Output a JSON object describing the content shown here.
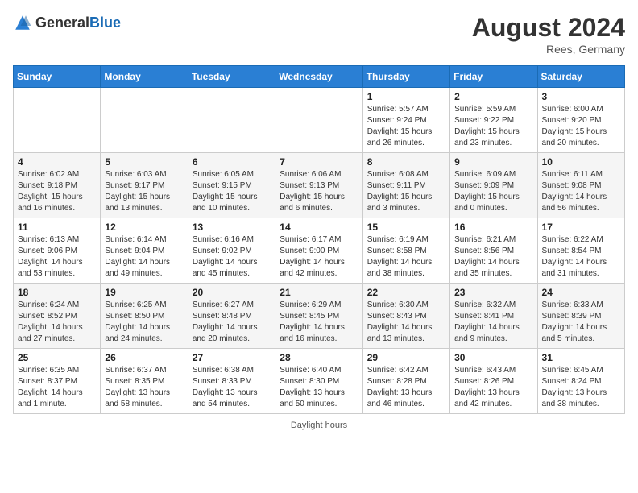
{
  "header": {
    "logo_general": "General",
    "logo_blue": "Blue",
    "month_year": "August 2024",
    "location": "Rees, Germany"
  },
  "days_of_week": [
    "Sunday",
    "Monday",
    "Tuesday",
    "Wednesday",
    "Thursday",
    "Friday",
    "Saturday"
  ],
  "weeks": [
    [
      {
        "day": "",
        "info": ""
      },
      {
        "day": "",
        "info": ""
      },
      {
        "day": "",
        "info": ""
      },
      {
        "day": "",
        "info": ""
      },
      {
        "day": "1",
        "info": "Sunrise: 5:57 AM\nSunset: 9:24 PM\nDaylight: 15 hours and 26 minutes."
      },
      {
        "day": "2",
        "info": "Sunrise: 5:59 AM\nSunset: 9:22 PM\nDaylight: 15 hours and 23 minutes."
      },
      {
        "day": "3",
        "info": "Sunrise: 6:00 AM\nSunset: 9:20 PM\nDaylight: 15 hours and 20 minutes."
      }
    ],
    [
      {
        "day": "4",
        "info": "Sunrise: 6:02 AM\nSunset: 9:18 PM\nDaylight: 15 hours and 16 minutes."
      },
      {
        "day": "5",
        "info": "Sunrise: 6:03 AM\nSunset: 9:17 PM\nDaylight: 15 hours and 13 minutes."
      },
      {
        "day": "6",
        "info": "Sunrise: 6:05 AM\nSunset: 9:15 PM\nDaylight: 15 hours and 10 minutes."
      },
      {
        "day": "7",
        "info": "Sunrise: 6:06 AM\nSunset: 9:13 PM\nDaylight: 15 hours and 6 minutes."
      },
      {
        "day": "8",
        "info": "Sunrise: 6:08 AM\nSunset: 9:11 PM\nDaylight: 15 hours and 3 minutes."
      },
      {
        "day": "9",
        "info": "Sunrise: 6:09 AM\nSunset: 9:09 PM\nDaylight: 15 hours and 0 minutes."
      },
      {
        "day": "10",
        "info": "Sunrise: 6:11 AM\nSunset: 9:08 PM\nDaylight: 14 hours and 56 minutes."
      }
    ],
    [
      {
        "day": "11",
        "info": "Sunrise: 6:13 AM\nSunset: 9:06 PM\nDaylight: 14 hours and 53 minutes."
      },
      {
        "day": "12",
        "info": "Sunrise: 6:14 AM\nSunset: 9:04 PM\nDaylight: 14 hours and 49 minutes."
      },
      {
        "day": "13",
        "info": "Sunrise: 6:16 AM\nSunset: 9:02 PM\nDaylight: 14 hours and 45 minutes."
      },
      {
        "day": "14",
        "info": "Sunrise: 6:17 AM\nSunset: 9:00 PM\nDaylight: 14 hours and 42 minutes."
      },
      {
        "day": "15",
        "info": "Sunrise: 6:19 AM\nSunset: 8:58 PM\nDaylight: 14 hours and 38 minutes."
      },
      {
        "day": "16",
        "info": "Sunrise: 6:21 AM\nSunset: 8:56 PM\nDaylight: 14 hours and 35 minutes."
      },
      {
        "day": "17",
        "info": "Sunrise: 6:22 AM\nSunset: 8:54 PM\nDaylight: 14 hours and 31 minutes."
      }
    ],
    [
      {
        "day": "18",
        "info": "Sunrise: 6:24 AM\nSunset: 8:52 PM\nDaylight: 14 hours and 27 minutes."
      },
      {
        "day": "19",
        "info": "Sunrise: 6:25 AM\nSunset: 8:50 PM\nDaylight: 14 hours and 24 minutes."
      },
      {
        "day": "20",
        "info": "Sunrise: 6:27 AM\nSunset: 8:48 PM\nDaylight: 14 hours and 20 minutes."
      },
      {
        "day": "21",
        "info": "Sunrise: 6:29 AM\nSunset: 8:45 PM\nDaylight: 14 hours and 16 minutes."
      },
      {
        "day": "22",
        "info": "Sunrise: 6:30 AM\nSunset: 8:43 PM\nDaylight: 14 hours and 13 minutes."
      },
      {
        "day": "23",
        "info": "Sunrise: 6:32 AM\nSunset: 8:41 PM\nDaylight: 14 hours and 9 minutes."
      },
      {
        "day": "24",
        "info": "Sunrise: 6:33 AM\nSunset: 8:39 PM\nDaylight: 14 hours and 5 minutes."
      }
    ],
    [
      {
        "day": "25",
        "info": "Sunrise: 6:35 AM\nSunset: 8:37 PM\nDaylight: 14 hours and 1 minute."
      },
      {
        "day": "26",
        "info": "Sunrise: 6:37 AM\nSunset: 8:35 PM\nDaylight: 13 hours and 58 minutes."
      },
      {
        "day": "27",
        "info": "Sunrise: 6:38 AM\nSunset: 8:33 PM\nDaylight: 13 hours and 54 minutes."
      },
      {
        "day": "28",
        "info": "Sunrise: 6:40 AM\nSunset: 8:30 PM\nDaylight: 13 hours and 50 minutes."
      },
      {
        "day": "29",
        "info": "Sunrise: 6:42 AM\nSunset: 8:28 PM\nDaylight: 13 hours and 46 minutes."
      },
      {
        "day": "30",
        "info": "Sunrise: 6:43 AM\nSunset: 8:26 PM\nDaylight: 13 hours and 42 minutes."
      },
      {
        "day": "31",
        "info": "Sunrise: 6:45 AM\nSunset: 8:24 PM\nDaylight: 13 hours and 38 minutes."
      }
    ]
  ],
  "footer": {
    "note": "Daylight hours"
  }
}
